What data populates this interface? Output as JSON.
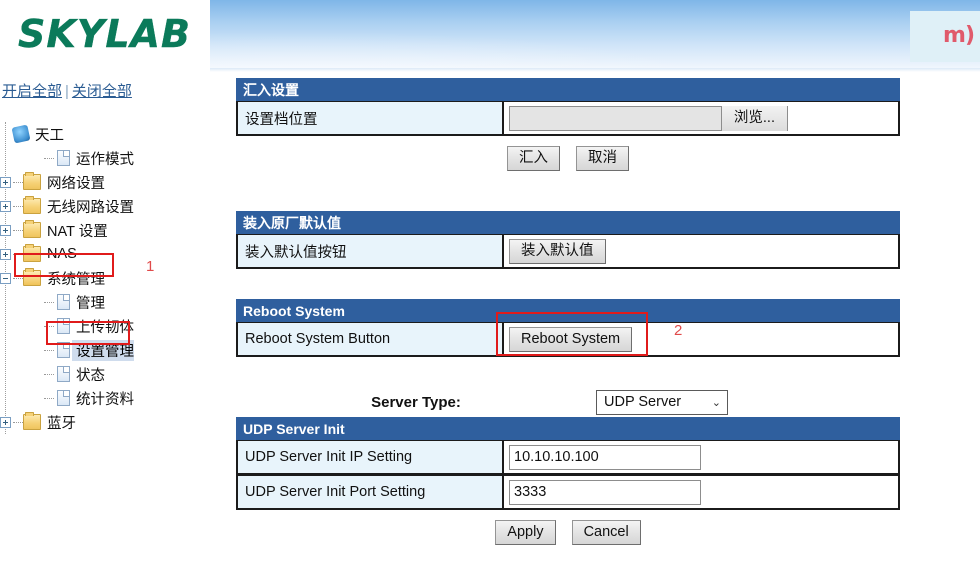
{
  "banner": {
    "brand": "SKYLAB",
    "corner_logo_glyph": "m)",
    "gradient_from": "#7fb6e8",
    "gradient_to": "#f6fafe"
  },
  "sidebar": {
    "expand_all_label": "开启全部",
    "separator": "|",
    "collapse_all_label": "关闭全部",
    "tree": [
      {
        "label": "天工",
        "icon": "computer-icon",
        "depth": 0,
        "toggle": "none",
        "selected": false
      },
      {
        "label": "运作模式",
        "icon": "page-icon",
        "depth": 1,
        "toggle": "none",
        "selected": false
      },
      {
        "label": "网络设置",
        "icon": "folder-icon",
        "depth": 0,
        "toggle": "plus",
        "selected": false
      },
      {
        "label": "无线网路设置",
        "icon": "folder-icon",
        "depth": 0,
        "toggle": "plus",
        "selected": false
      },
      {
        "label": "NAT 设置",
        "icon": "folder-icon",
        "depth": 0,
        "toggle": "plus",
        "selected": false
      },
      {
        "label": "NAS",
        "icon": "folder-icon",
        "depth": 0,
        "toggle": "plus",
        "selected": false
      },
      {
        "label": "系统管理",
        "icon": "folder-open-icon",
        "depth": 0,
        "toggle": "minus",
        "selected": false
      },
      {
        "label": "管理",
        "icon": "page-icon",
        "depth": 1,
        "toggle": "none",
        "selected": false
      },
      {
        "label": "上传韧体",
        "icon": "page-icon",
        "depth": 1,
        "toggle": "none",
        "selected": false
      },
      {
        "label": "设置管理",
        "icon": "page-icon",
        "depth": 1,
        "toggle": "none",
        "selected": true
      },
      {
        "label": "状态",
        "icon": "page-icon",
        "depth": 1,
        "toggle": "none",
        "selected": false
      },
      {
        "label": "统计资料",
        "icon": "page-icon",
        "depth": 1,
        "toggle": "none",
        "selected": false
      },
      {
        "label": "蓝牙",
        "icon": "folder-icon",
        "depth": 0,
        "toggle": "plus",
        "selected": false
      }
    ]
  },
  "annotations": {
    "color": "#e01b1b",
    "number_color": "#e04a4a",
    "marker_1": "1",
    "marker_2": "2"
  },
  "main": {
    "import_panel": {
      "title": "汇入设置",
      "row_label": "设置档位置",
      "file_value": "",
      "browse_label": "浏览...",
      "submit_label": "汇入",
      "cancel_label": "取消"
    },
    "factory_panel": {
      "title": "装入原厂默认值",
      "row_label": "装入默认值按钮",
      "button_label": "装入默认值"
    },
    "reboot_panel": {
      "title": "Reboot System",
      "row_label": "Reboot System Button",
      "button_label": "Reboot System"
    },
    "server_type": {
      "label": "Server Type:",
      "selected": "UDP Server",
      "caret": "⌄"
    },
    "udp_panel": {
      "title": "UDP Server Init",
      "rows": [
        {
          "label": "UDP Server Init IP Setting",
          "value": "10.10.10.100"
        },
        {
          "label": "UDP Server Init Port Setting",
          "value": "3333"
        }
      ],
      "apply_label": "Apply",
      "cancel_label": "Cancel"
    }
  }
}
